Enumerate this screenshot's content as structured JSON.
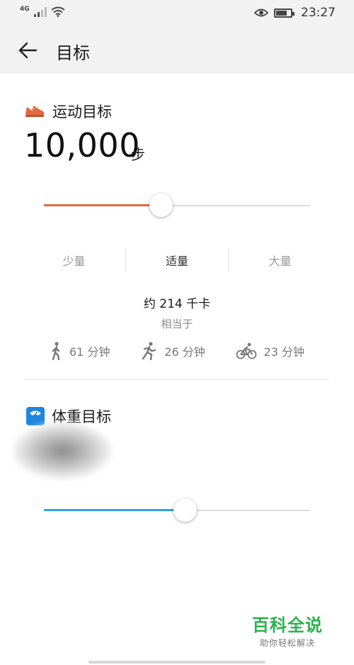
{
  "status_bar": {
    "network": "4G",
    "time": "23:27"
  },
  "app_bar": {
    "title": "目标"
  },
  "exercise_goal": {
    "title": "运动目标",
    "value": "10,000",
    "unit": "步",
    "slider_fraction": 0.44,
    "accent_color": "#e06a3f",
    "levels": [
      "少量",
      "适量",
      "大量"
    ],
    "active_level": 1,
    "calories": "约 214 千卡",
    "equivalent_label": "相当于",
    "activities": [
      {
        "icon": "walking-icon",
        "text": "61 分钟"
      },
      {
        "icon": "running-icon",
        "text": "26 分钟"
      },
      {
        "icon": "cycling-icon",
        "text": "23 分钟"
      }
    ]
  },
  "weight_goal": {
    "title": "体重目标",
    "slider_fraction": 0.53,
    "accent_color": "#2fa3e0"
  },
  "watermark": {
    "main": "百科全说",
    "sub": "助你轻松解决"
  }
}
